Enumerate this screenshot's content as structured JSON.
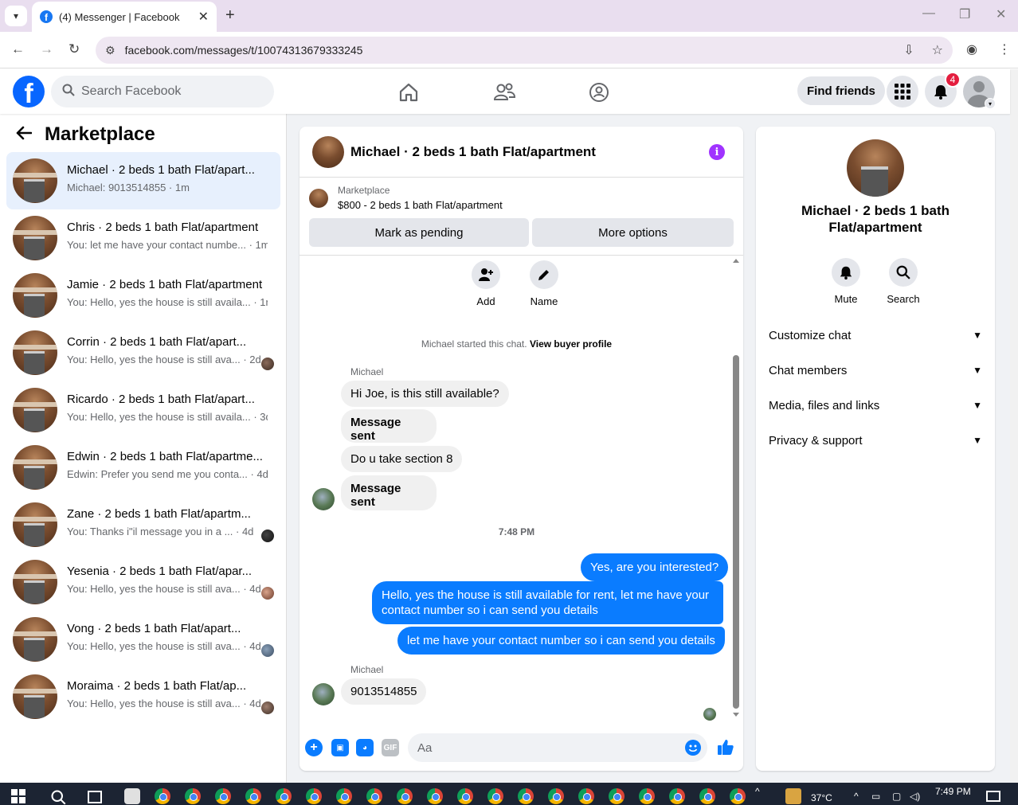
{
  "browser": {
    "tab_title": "(4) Messenger | Facebook",
    "url": "facebook.com/messages/t/10074313679333245"
  },
  "header": {
    "search_placeholder": "Search Facebook",
    "find_friends": "Find friends",
    "notification_count": "4"
  },
  "sidebar": {
    "title": "Marketplace",
    "conversations": [
      {
        "name": "Michael · 2 beds 1 bath Flat/apart...",
        "preview": "Michael: 9013514855 · 1m",
        "active": true
      },
      {
        "name": "Chris · 2 beds 1 bath Flat/apartment",
        "preview": "You: let me have your contact numbe... · 1m"
      },
      {
        "name": "Jamie · 2 beds 1 bath Flat/apartment",
        "preview": "You: Hello, yes the house is still availa... · 1m"
      },
      {
        "name": "Corrin · 2 beds 1 bath Flat/apart...",
        "preview": "You: Hello, yes the house is still ava... · 2d"
      },
      {
        "name": "Ricardo · 2 beds 1 bath Flat/apart...",
        "preview": "You: Hello, yes the house is still availa... · 3d"
      },
      {
        "name": "Edwin · 2 beds 1 bath Flat/apartme...",
        "preview": "Edwin: Prefer you send me you conta... · 4d"
      },
      {
        "name": "Zane · 2 beds 1 bath Flat/apartm...",
        "preview": "You: Thanks i\"il message you in a ... · 4d"
      },
      {
        "name": "Yesenia · 2 beds 1 bath Flat/apar...",
        "preview": "You: Hello, yes the house is still ava... · 4d"
      },
      {
        "name": "Vong · 2 beds 1 bath Flat/apart...",
        "preview": "You: Hello, yes the house is still ava... · 4d"
      },
      {
        "name": "Moraima · 2 beds 1 bath Flat/ap...",
        "preview": "You: Hello, yes the house is still ava... · 4d"
      }
    ]
  },
  "chat": {
    "title": "Michael · 2 beds 1 bath Flat/apartment",
    "listing_category": "Marketplace",
    "listing_price": "$800 - 2 beds 1 bath Flat/apartment",
    "mark_pending": "Mark as pending",
    "more_options": "More options",
    "quick_add": "Add",
    "quick_name": "Name",
    "system_message": "Michael started this chat.",
    "view_buyer": "View buyer profile",
    "sender": "Michael",
    "incoming_1": [
      "Hi Joe, is this still available?",
      "Message sent",
      "Do u take section 8",
      "Message sent"
    ],
    "timestamp": "7:48 PM",
    "outgoing": [
      "Yes, are you interested?",
      "Hello, yes the house is still available for rent, let me have your contact number so i can send you details",
      "let me have your contact number so i can send you details"
    ],
    "incoming_2": "9013514855",
    "composer_placeholder": "Aa"
  },
  "details": {
    "name": "Michael · 2 beds 1 bath Flat/apartment",
    "mute": "Mute",
    "search": "Search",
    "sections": [
      "Customize chat",
      "Chat members",
      "Media, files and links",
      "Privacy & support"
    ]
  },
  "taskbar": {
    "temperature": "37°C",
    "time": "7:49 PM"
  },
  "colors": {
    "brand": "#0866ff",
    "outgoing_bubble": "#0a7cff",
    "info_icon": "#a033ff",
    "badge": "#e41e3f"
  }
}
